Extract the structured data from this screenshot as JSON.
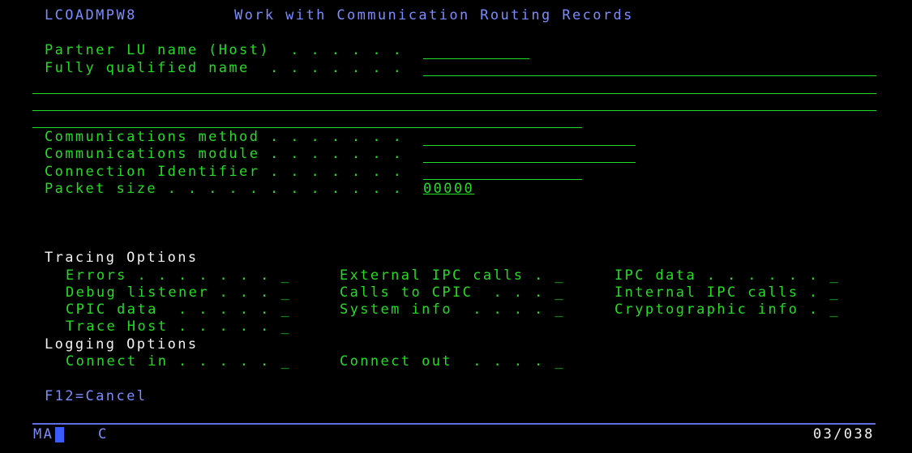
{
  "header": {
    "program": "LCOADMPW8",
    "title": "Work with Communication Routing Records"
  },
  "fields": {
    "partner_lu": "Partner LU name (Host)  . . . . . .",
    "fully_qualified": "Fully qualified name  . . . . . . .",
    "comm_method": "Communications method . . . . . . .",
    "comm_module": "Communications module . . . . . . .",
    "connection_id": "Connection Identifier . . . . . . .",
    "packet_size": "Packet size . . . . . . . . . . . .",
    "packet_size_value": "00000"
  },
  "tracing": {
    "heading": "Tracing Options",
    "errors": "Errors . . . . . . . _",
    "debug_listener": "Debug listener . . . _",
    "cpic_data": "CPIC data  . . . . . _",
    "trace_host": "Trace Host . . . . . _",
    "external_ipc": "External IPC calls . _",
    "calls_to_cpic": "Calls to CPIC  . . . _",
    "system_info": "System info  . . . . _",
    "ipc_data": "IPC data . . . . . . _",
    "internal_ipc": "Internal IPC calls . _",
    "crypto_info": "Cryptographic info . _"
  },
  "logging": {
    "heading": "Logging Options",
    "connect_in": "Connect in . . . . . _",
    "connect_out": "Connect out  . . . . _"
  },
  "function_keys": {
    "f12": "F12=Cancel"
  },
  "status_bar": {
    "mode": "MA",
    "indicator": "C",
    "cursor_position": "03/038"
  },
  "colors": {
    "background": "#000000",
    "green": "#22dd22",
    "blue": "#7b8cff",
    "white": "#f2f2f2",
    "cursor": "#3a5cff"
  }
}
